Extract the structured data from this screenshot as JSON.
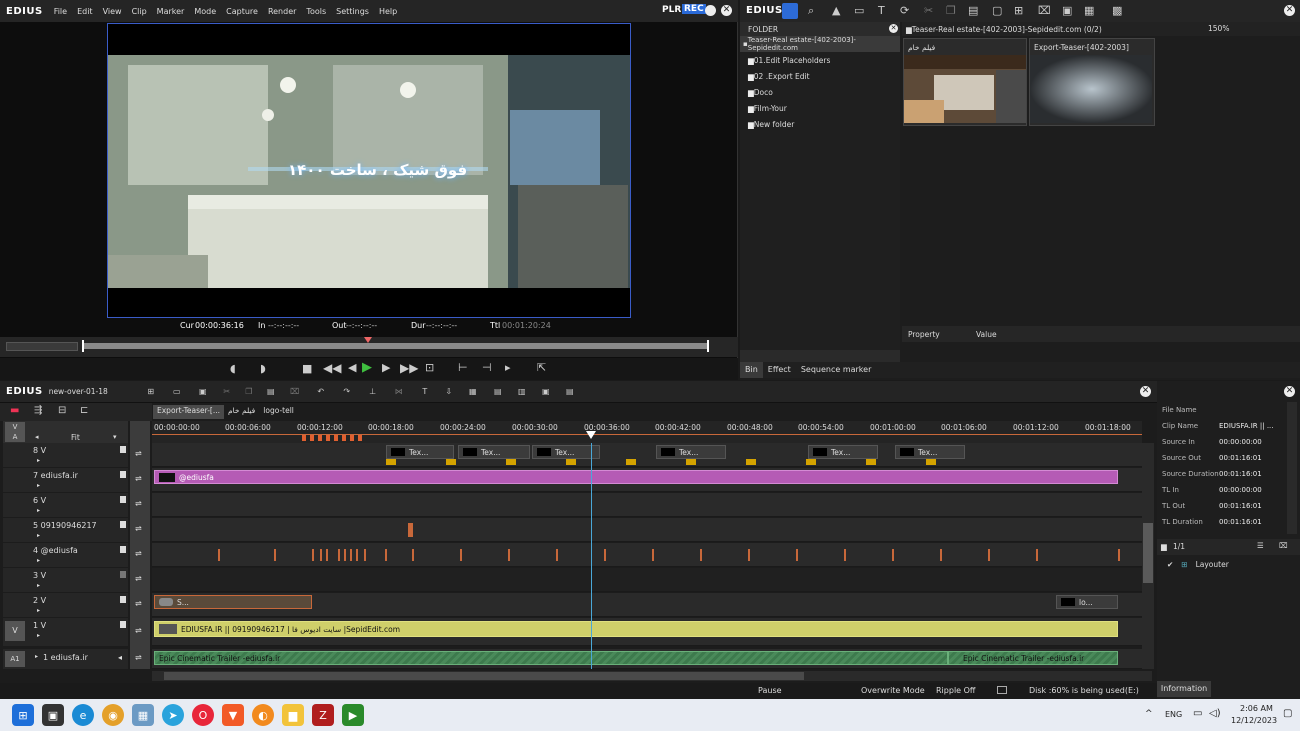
{
  "player": {
    "brand": "EDIUS",
    "menu": [
      "File",
      "Edit",
      "View",
      "Clip",
      "Marker",
      "Mode",
      "Capture",
      "Render",
      "Tools",
      "Settings",
      "Help"
    ],
    "plr": "PLR",
    "rec": "REC",
    "overlay_text": "فوق شیک ، ساخت ۱۴۰۰",
    "timecode": {
      "cur_label": "Cur",
      "cur": "00:00:36:16",
      "in_label": "In",
      "in": "--:--:--:--",
      "out_label": "Out",
      "out": "--:--:--:--",
      "dur_label": "Dur",
      "dur": "--:--:--:--",
      "ttl_label": "Ttl",
      "ttl": "00:01:20:24"
    }
  },
  "bin": {
    "brand": "EDIUS",
    "folder_header": "FOLDER",
    "root": "Teaser-Real estate-[402-2003]-Sepidedit.com",
    "folders": [
      "01.Edit Placeholders",
      "02 .Export Edit",
      "Doco",
      "Film-Your",
      "New folder"
    ],
    "path": "Teaser-Real estate-[402-2003]-Sepidedit.com (0/2)",
    "zoom": "150%",
    "clips": [
      {
        "name": "فیلم خام"
      },
      {
        "name": "Export-Teaser-[402-2003]"
      }
    ],
    "property_col": "Property",
    "value_col": "Value",
    "tabs": [
      "Bin",
      "Effect",
      "Sequence marker"
    ]
  },
  "timeline": {
    "brand": "EDIUS",
    "sequence": "new-over-01-18",
    "seq_tabs": [
      "Export-Teaser-[...",
      "فیلم خام",
      "logo-tell"
    ],
    "fit": "Fit",
    "ruler": [
      "00:00:00:00",
      "00:00:06:00",
      "00:00:12:00",
      "00:00:18:00",
      "00:00:24:00",
      "00:00:30:00",
      "00:00:36:00",
      "00:00:42:00",
      "00:00:48:00",
      "00:00:54:00",
      "00:01:00:00",
      "00:01:06:00",
      "00:01:12:00",
      "00:01:18:00"
    ],
    "tracks": [
      {
        "label": "8 V"
      },
      {
        "label": "7 ediusfa.ir"
      },
      {
        "label": "6 V"
      },
      {
        "label": "5 09190946217"
      },
      {
        "label": "4 @ediusfa"
      },
      {
        "label": "3 V"
      },
      {
        "label": "2 V"
      },
      {
        "label": "1 V"
      },
      {
        "label": "1 ediusfa.ir"
      }
    ],
    "track_prefix": {
      "v": "V",
      "a": "A",
      "v1": "V",
      "a1": "A1"
    },
    "clip_text": "Tex...",
    "clip_s": "S...",
    "clip_lo": "lo...",
    "clip_7": "@ediusfa",
    "clip_v1": "EDIUSFA.IR || 09190946217  | سایت ادیوس فا |SepidEdit.com",
    "clip_a1_a": "Epic Cinematic Trailer -ediusfa.ir",
    "clip_a1_b": "Epic Cinematic Trailer -ediusfa.ir"
  },
  "status": {
    "pause": "Pause",
    "mode": "Overwrite Mode",
    "ripple": "Ripple Off",
    "disk": "Disk :60% is being used(E:)"
  },
  "info": {
    "rows": [
      {
        "k": "File Name",
        "v": ""
      },
      {
        "k": "Clip Name",
        "v": "EDIUSFA.IR || ..."
      },
      {
        "k": "Source In",
        "v": "00:00:00:00"
      },
      {
        "k": "Source Out",
        "v": "00:01:16:01"
      },
      {
        "k": "Source Duration",
        "v": "00:01:16:01"
      },
      {
        "k": "TL In",
        "v": "00:00:00:00"
      },
      {
        "k": "TL Out",
        "v": "00:01:16:01"
      },
      {
        "k": "TL Duration",
        "v": "00:01:16:01"
      }
    ],
    "layer_count": "1/1",
    "layouter": "Layouter",
    "tab": "Information"
  },
  "taskbar": {
    "lang": "ENG",
    "time": "2:06 AM",
    "date": "12/12/2023"
  }
}
